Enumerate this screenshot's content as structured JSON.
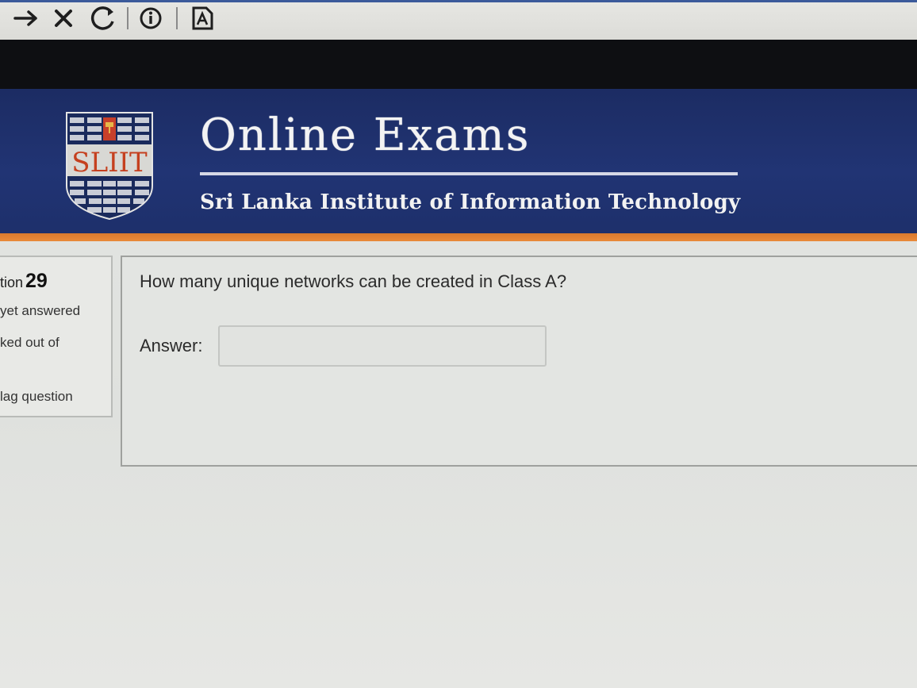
{
  "browser": {
    "icons": [
      "forward-arrow-icon",
      "close-icon",
      "reload-icon",
      "info-icon",
      "reader-icon"
    ]
  },
  "header": {
    "logo_text": "SLIIT",
    "title": "Online Exams",
    "subtitle": "Sri Lanka Institute of Information Technology",
    "colors": {
      "banner": "#213474",
      "stripe": "#e98a3a"
    }
  },
  "question_info": {
    "label": "tion",
    "number": "29",
    "state": "yet answered",
    "marks": "ked out of",
    "flag": "lag question"
  },
  "question": {
    "text": "How many unique networks can be created in Class A?",
    "answer_label": "Answer:",
    "answer_value": ""
  }
}
